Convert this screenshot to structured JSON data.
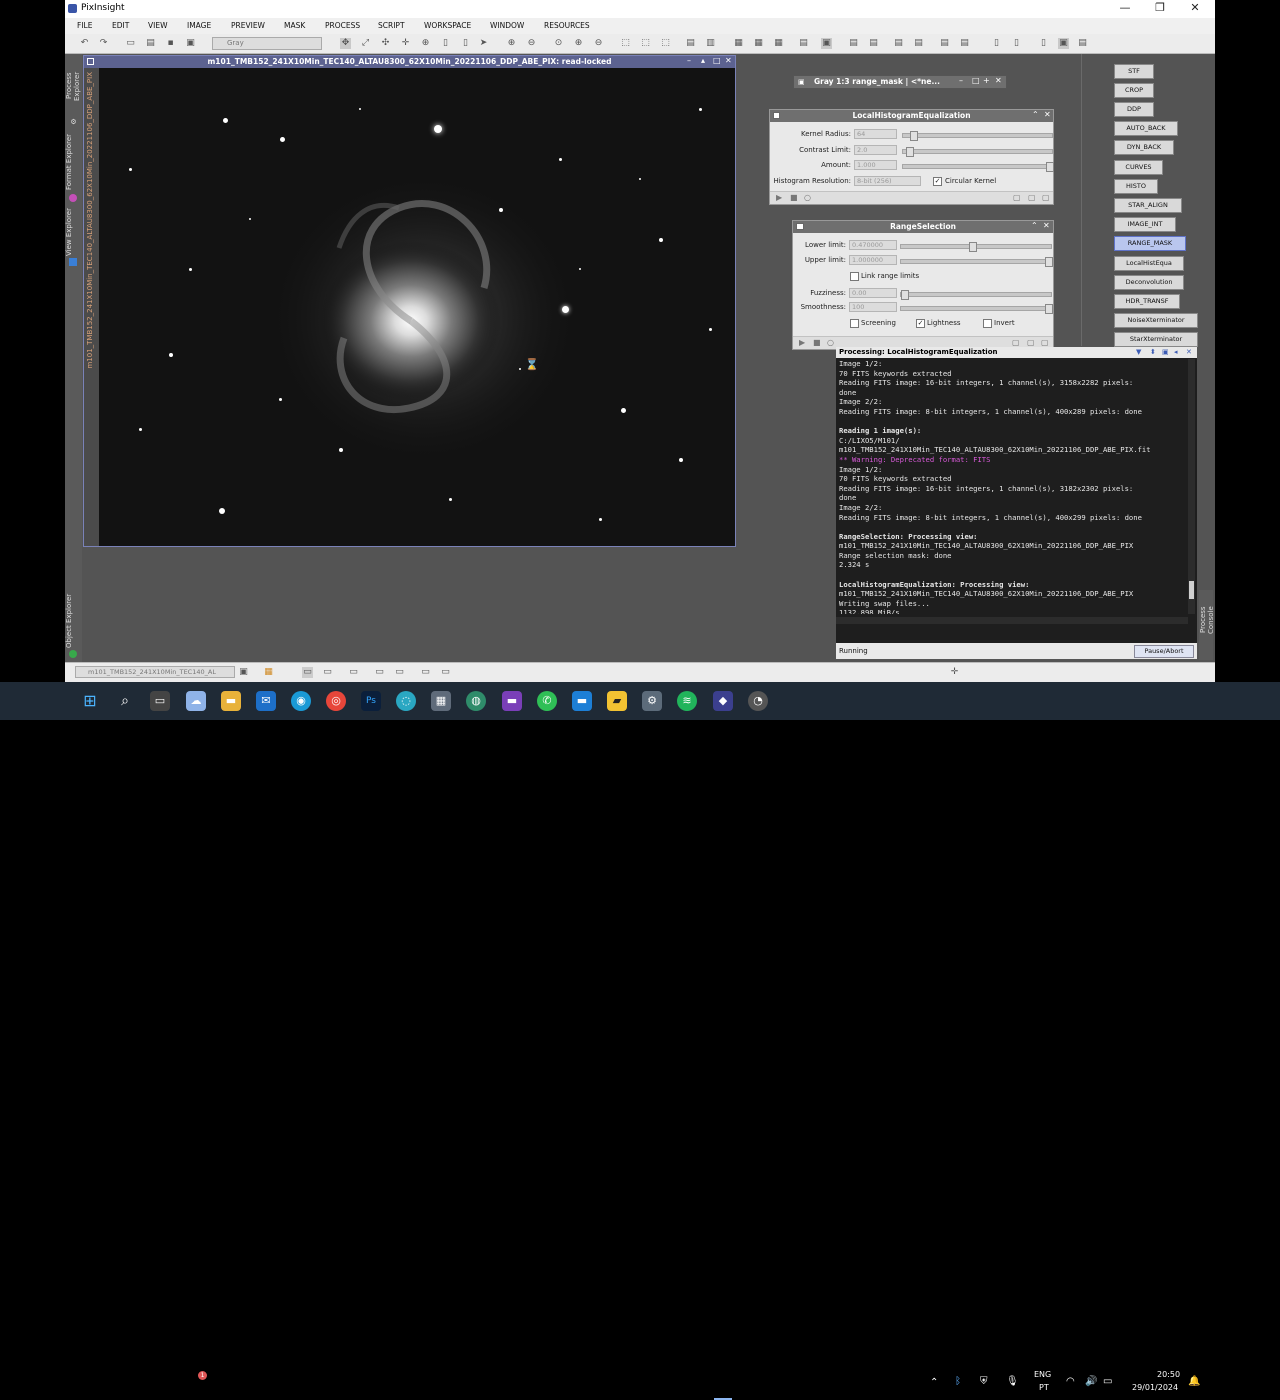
{
  "app": {
    "title": "PixInsight",
    "window_controls": {
      "minimize": "—",
      "maximize": "❐",
      "close": "✕"
    }
  },
  "menu": [
    "FILE",
    "EDIT",
    "VIEW",
    "IMAGE",
    "PREVIEW",
    "MASK",
    "PROCESS",
    "SCRIPT",
    "WORKSPACE",
    "WINDOW",
    "RESOURCES"
  ],
  "toolbar": {
    "view_mode_value": "Gray"
  },
  "side_tabs": {
    "process_explorer": "Process Explorer",
    "format_explorer": "Format Explorer",
    "view_explorer": "View Explorer",
    "object_explorer": "Object Explorer"
  },
  "image_window": {
    "title": "m101_TMB152_241X10Min_TEC140_ALTAU8300_62X10Min_20221106_DDP_ABE_PIX: read-locked",
    "side_label": "m101_TMB152_241X10Min_TEC140_ALTAU8300_62X10Min_20221106_DDP_ABE_PIX"
  },
  "mask_window": {
    "title": "Gray 1:3 range_mask | <*ne..."
  },
  "lhe": {
    "title": "LocalHistogramEqualization",
    "kernel_radius_label": "Kernel Radius:",
    "kernel_radius": "64",
    "contrast_limit_label": "Contrast Limit:",
    "contrast_limit": "2.0",
    "amount_label": "Amount:",
    "amount": "1.000",
    "histogram_resolution_label": "Histogram Resolution:",
    "histogram_resolution": "8-bit (256)",
    "circular_kernel_label": "Circular Kernel",
    "kernel_radius_fraction": 0.05,
    "contrast_limit_fraction": 0.02,
    "amount_fraction": 1.0
  },
  "range": {
    "title": "RangeSelection",
    "lower_label": "Lower limit:",
    "lower": "0.470000",
    "upper_label": "Upper limit:",
    "upper": "1.000000",
    "link_label": "Link range limits",
    "fuzziness_label": "Fuzziness:",
    "fuzziness": "0.00",
    "smoothness_label": "Smoothness:",
    "smoothness": "100",
    "screening_label": "Screening",
    "lightness_label": "Lightness",
    "invert_label": "Invert",
    "lower_fraction": 0.47,
    "upper_fraction": 1.0,
    "fuzziness_fraction": 0.0,
    "smoothness_fraction": 1.0
  },
  "process_buttons": [
    "STF",
    "CROP",
    "DDP",
    "AUTO_BACK",
    "DYN_BACK",
    "CURVES",
    "HISTO",
    "STAR_ALIGN",
    "IMAGE_INT",
    "RANGE_MASK",
    "LocalHistEqua",
    "Deconvolution",
    "HDR_TRANSF",
    "NoiseXterminator",
    "StarXterminator"
  ],
  "console": {
    "title": "Processing: LocalHistogramEqualization",
    "lines": [
      "Image 1/2:",
      "70 FITS keywords extracted",
      "Reading FITS image: 16-bit integers, 1 channel(s), 3158x2282 pixels:",
      "done",
      "Image 2/2:",
      "Reading FITS image: 8-bit integers, 1 channel(s), 400x289 pixels: done",
      "",
      "Reading 1 image(s):",
      "C:/LIXO5/M101/",
      "m101_TMB152_241X10Min_TEC140_ALTAU8300_62X10Min_20221106_DDP_ABE_PIX.fit",
      "** Warning: Deprecated format: FITS",
      "Image 1/2:",
      "70 FITS keywords extracted",
      "Reading FITS image: 16-bit integers, 1 channel(s), 3182x2302 pixels:",
      "done",
      "Image 2/2:",
      "Reading FITS image: 8-bit integers, 1 channel(s), 400x299 pixels: done",
      "",
      "RangeSelection: Processing view:",
      "m101_TMB152_241X10Min_TEC140_ALTAU8300_62X10Min_20221106_DDP_ABE_PIX",
      "Range selection mask: done",
      "2.324 s",
      "",
      "LocalHistogramEqualization: Processing view:",
      "m101_TMB152_241X10Min_TEC140_ALTAU8300_62X10Min_20221106_DDP_ABE_PIX",
      "Writing swap files...",
      "1132.898 MiB/s"
    ],
    "status": "Running",
    "pause_label": "Pause/Abort",
    "side_label": "Process Console"
  },
  "bottom_strip": {
    "view_selector": "m101_TMB152_241X10Min_TEC140_AL"
  },
  "taskbar": {
    "language_line1": "ENG",
    "language_line2": "PT",
    "time": "20:50",
    "date": "29/01/2024",
    "badge_count": "1"
  }
}
